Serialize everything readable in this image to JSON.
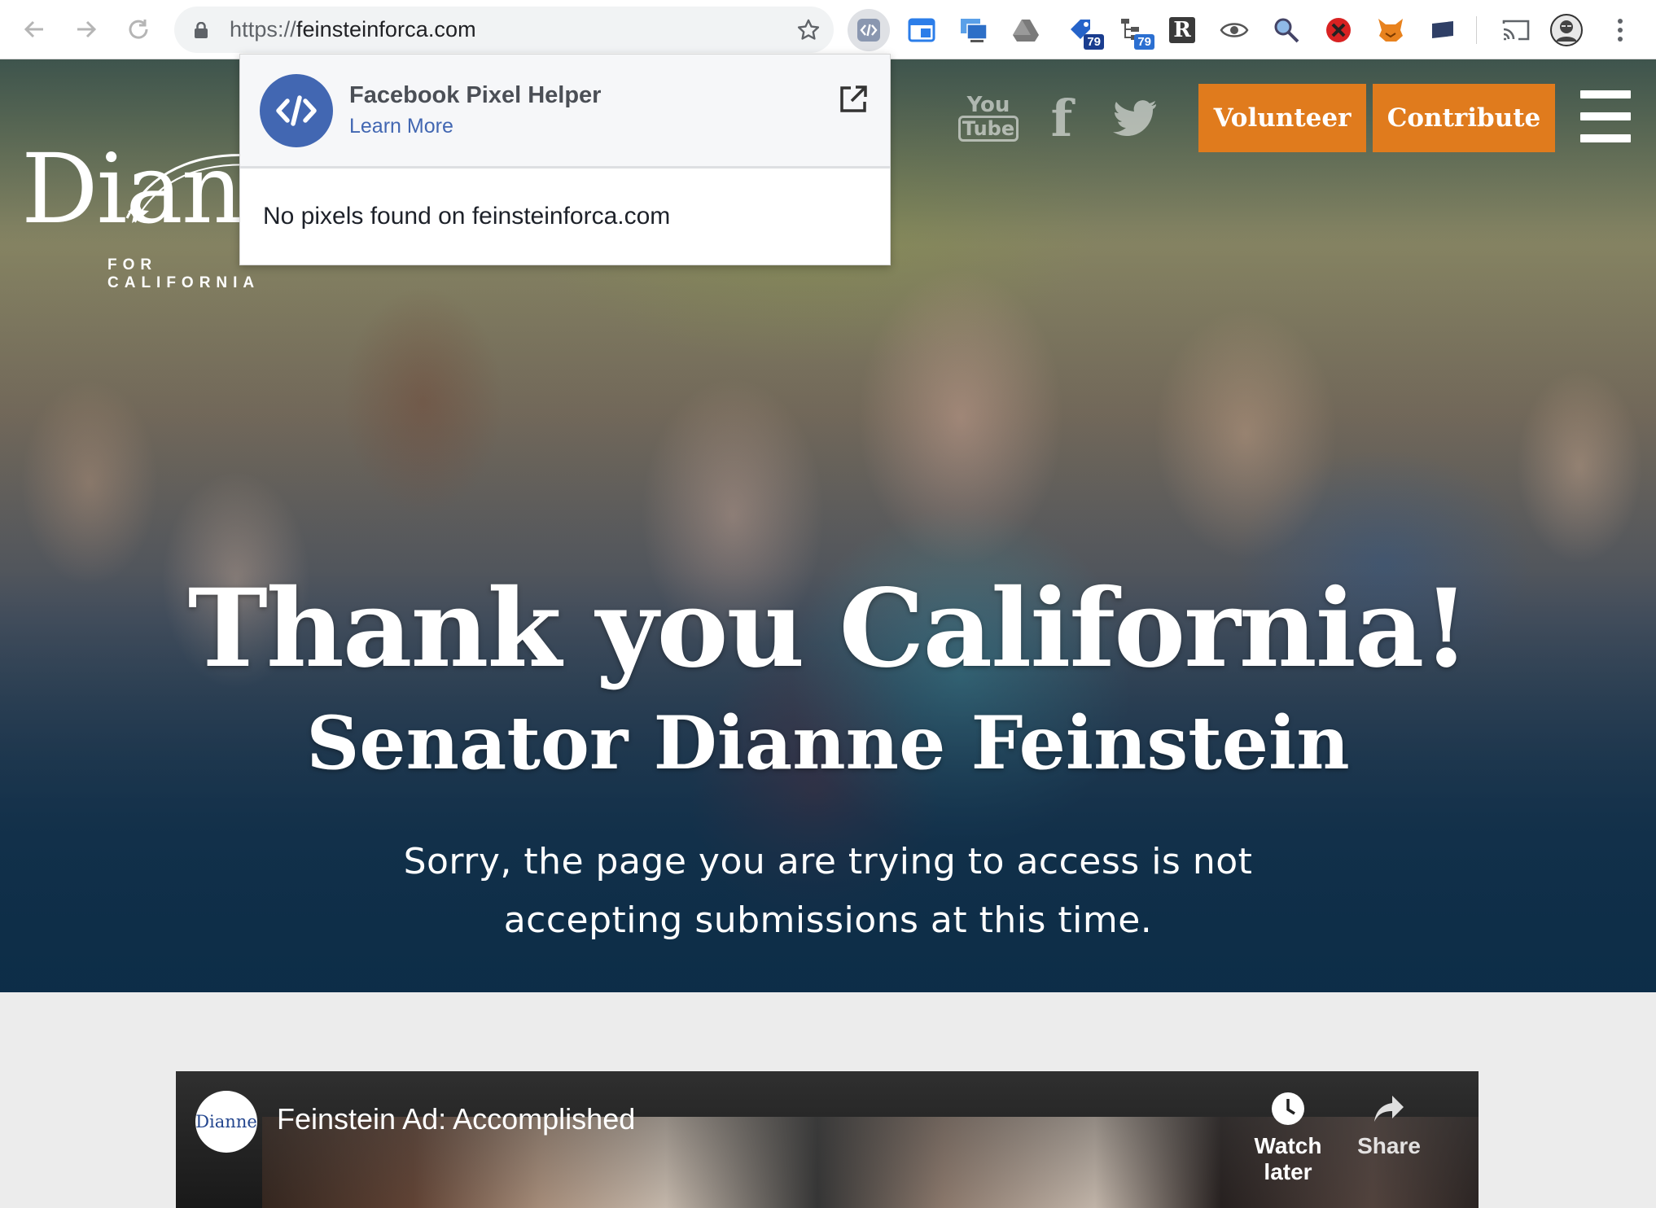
{
  "browser": {
    "url_scheme": "https://",
    "url_host": "feinsteinforca.com",
    "extensions": [
      {
        "name": "pixel-helper",
        "badge": ""
      },
      {
        "name": "ext-window",
        "badge": ""
      },
      {
        "name": "ext-screens",
        "badge": ""
      },
      {
        "name": "ext-drive",
        "badge": ""
      },
      {
        "name": "ext-tag",
        "badge": "79"
      },
      {
        "name": "ext-tree",
        "badge": "79"
      },
      {
        "name": "ext-r",
        "badge": ""
      },
      {
        "name": "ext-eye",
        "badge": ""
      },
      {
        "name": "ext-search",
        "badge": ""
      },
      {
        "name": "ext-block",
        "badge": ""
      },
      {
        "name": "ext-fox",
        "badge": ""
      },
      {
        "name": "ext-screen",
        "badge": ""
      }
    ],
    "ext_r_label": "R"
  },
  "popup": {
    "title": "Facebook Pixel Helper",
    "link": "Learn More",
    "message": "No pixels found on feinsteinforca.com"
  },
  "site": {
    "logo_word": "Dianne",
    "logo_sub": "FOR CALIFORNIA",
    "social": {
      "youtube_top": "You",
      "youtube_bottom": "Tube",
      "facebook": "f"
    },
    "nav": {
      "volunteer": "Volunteer",
      "contribute": "Contribute"
    },
    "headline": "Thank you California!",
    "subhead": "Senator Dianne Feinstein",
    "message": "Sorry, the page you are trying to access is not accepting submissions at this time.",
    "video": {
      "channel": "Dianne",
      "title": "Feinstein Ad: Accomplished",
      "watch_later": "Watch later",
      "share": "Share"
    }
  }
}
